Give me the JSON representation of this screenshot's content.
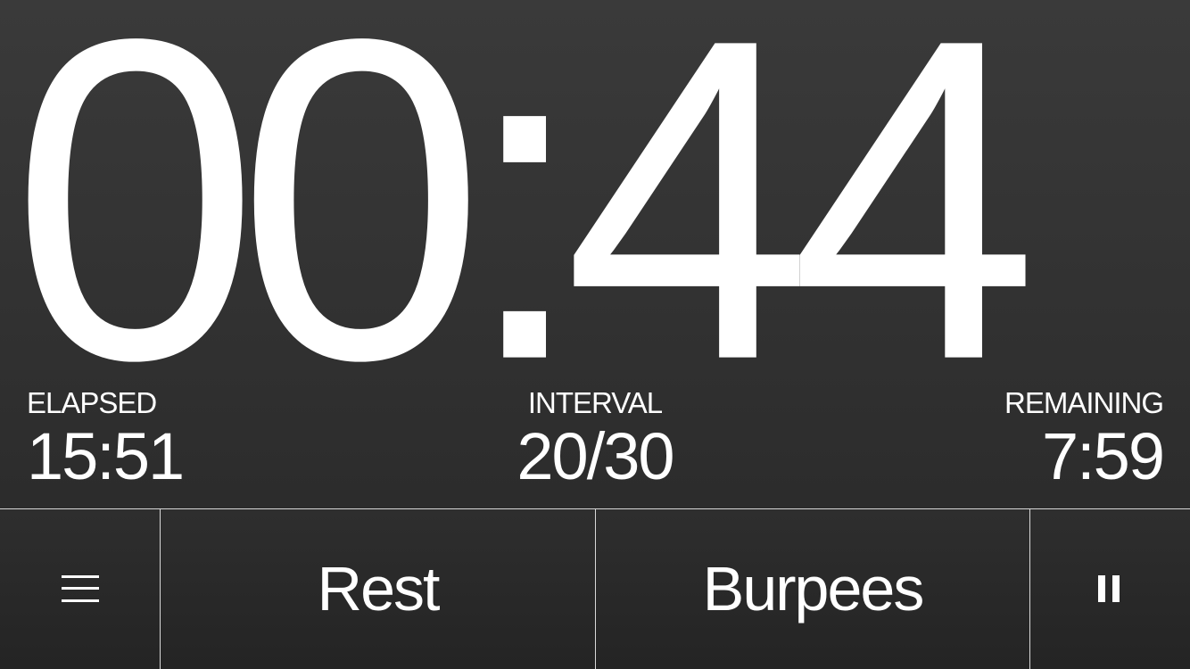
{
  "timer": {
    "display": "00:44"
  },
  "stats": {
    "elapsed": {
      "label": "ELAPSED",
      "value": "15:51"
    },
    "interval": {
      "label": "INTERVAL",
      "value": "20/30"
    },
    "remaining": {
      "label": "REMAINING",
      "value": "7:59"
    }
  },
  "bottom_bar": {
    "menu_icon": "menu-icon",
    "current_label": "Rest",
    "next_label": "Burpees",
    "pause_icon": "pause-icon"
  },
  "colors": {
    "background": "#333333",
    "text": "#ffffff",
    "divider": "#d8d8d8"
  }
}
